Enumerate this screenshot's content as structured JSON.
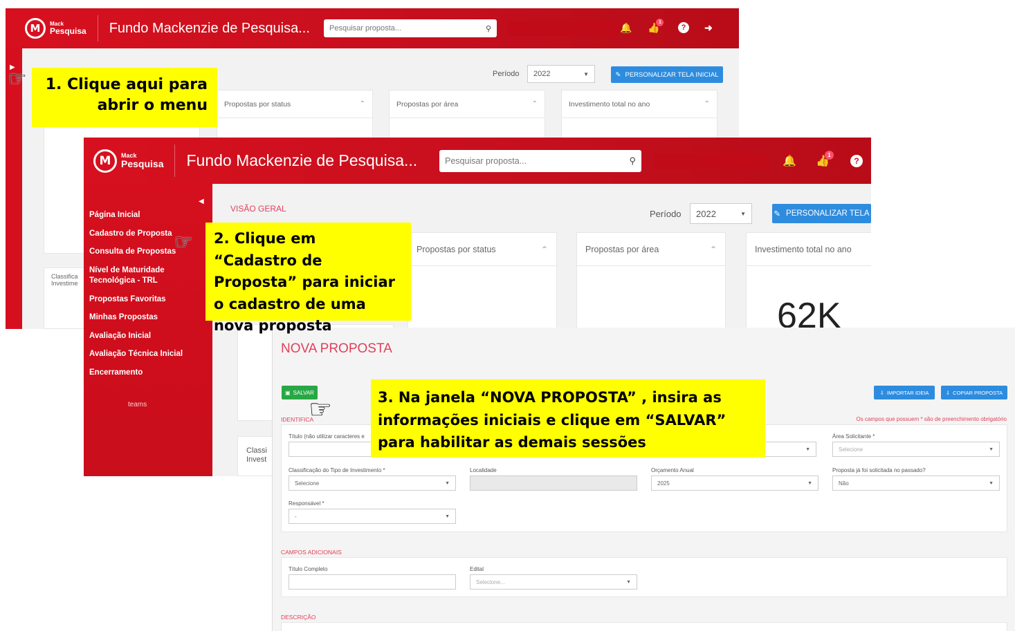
{
  "app": {
    "logo_small": "Mack",
    "logo_large": "Pesquisa",
    "logo_letter": "M",
    "title": "Fundo Mackenzie de Pesquisa...",
    "search_placeholder": "Pesquisar proposta...",
    "notification_badge": "1"
  },
  "screen1": {
    "period_label": "Período",
    "period_value": "2022",
    "customize_button": "PERSONALIZAR TELA INICIAL",
    "panels": [
      "Propostas por status",
      "Propostas por área",
      "Investimento total no ano"
    ],
    "classification_partial": "Classifica Investime"
  },
  "screen2": {
    "section_title": "VISÃO GERAL",
    "period_label": "Período",
    "period_value": "2022",
    "customize_button": "PERSONALIZAR TELA",
    "panels": [
      "Propostas por status",
      "Propostas por área",
      "Investimento total no ano"
    ],
    "investment_value": "62K",
    "classification_partial": "Classi Invest",
    "sidebar_items": [
      "Página Inicial",
      "Cadastro de Proposta",
      "Consulta de Propostas",
      "Nível de Maturidade Tecnológica - TRL",
      "Propostas Favoritas",
      "Minhas Propostas",
      "Avaliação Inicial",
      "Avaliação Técnica Inicial",
      "Encerramento"
    ],
    "sidebar_footer": "teams"
  },
  "screen3": {
    "title": "NOVA PROPOSTA",
    "save_button": "SALVAR",
    "import_button": "IMPORTAR IDEIA",
    "copy_button": "COPIAR PROPOSTA",
    "required_note": "Os campos que possuem * são de preenchimento obrigatório",
    "section_identification": "IDENTIFICA",
    "section_additional": "CAMPOS ADICIONAIS",
    "section_description": "DESCRIÇÃO",
    "fields": {
      "titulo_label": "Título (não utilizar caracteres e",
      "area_label": "Área Solicitante *",
      "area_value": "Selecione",
      "classificacao_label": "Classificação do Tipo de Investimento *",
      "classificacao_value": "Selecione",
      "localidade_label": "Localidade",
      "orcamento_label": "Orçamento Anual",
      "orcamento_value": "2025",
      "proposta_label": "Proposta já foi solicitada no passado?",
      "proposta_value": "Não",
      "responsavel_label": "Responsável *",
      "responsavel_value": "-",
      "titulo_completo_label": "Título Completo",
      "edital_label": "Edital",
      "edital_value": "Selecione..."
    }
  },
  "callouts": {
    "step1": "1. Clique aqui para abrir o menu",
    "step2": "2. Clique em “Cadastro de Proposta” para iniciar o cadastro de uma nova proposta",
    "step3": "3. Na janela “NOVA PROPOSTA” , insira as informações iniciais e clique em “SALVAR” para habilitar as demais sessões"
  },
  "colors": {
    "brand_red": "#d7101f",
    "accent_blue": "#2e8cdf",
    "save_green": "#27a844",
    "callout_yellow": "#ffff00"
  },
  "icons": [
    "search-icon",
    "bell-icon",
    "thumbs-up-icon",
    "help-icon",
    "logout-icon",
    "chevron-up-icon",
    "caret-down-icon",
    "pointer-hand-icon",
    "pencil-icon",
    "save-icon",
    "import-icon",
    "copy-icon"
  ]
}
